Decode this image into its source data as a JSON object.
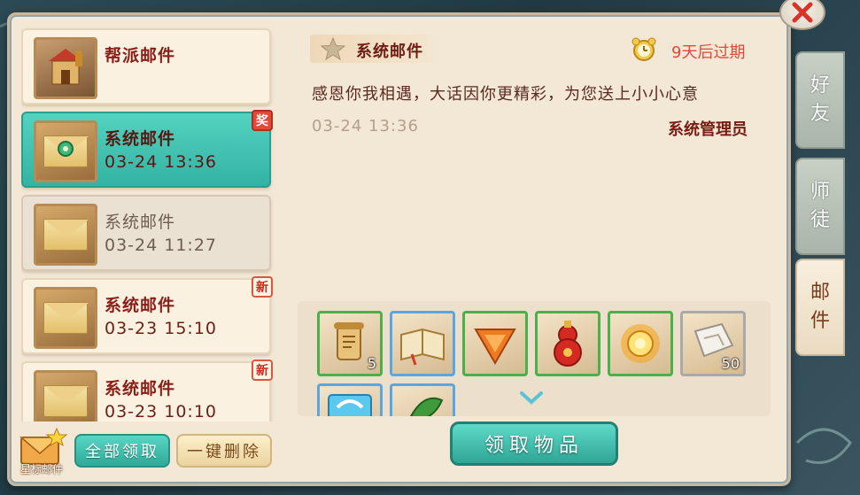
{
  "mail_list": [
    {
      "title": "帮派邮件",
      "date": "",
      "icon": "guild-building-icon",
      "state": "normal",
      "badge": ""
    },
    {
      "title": "系统邮件",
      "date": "03-24 13:36",
      "icon": "envelope-reward-icon",
      "state": "selected",
      "badge": "奖"
    },
    {
      "title": "系统邮件",
      "date": "03-24 11:27",
      "icon": "envelope-open-icon",
      "state": "read",
      "badge": ""
    },
    {
      "title": "系统邮件",
      "date": "03-23 15:10",
      "icon": "envelope-icon",
      "state": "normal",
      "badge": "新"
    },
    {
      "title": "系统邮件",
      "date": "03-23 10:10",
      "icon": "envelope-icon",
      "state": "normal",
      "badge": "新"
    }
  ],
  "footer": {
    "star_label": "星标邮件",
    "claim_all": "全部领取",
    "delete_all": "一键删除"
  },
  "detail": {
    "title": "系统邮件",
    "expire": "9天后过期",
    "body": "感恩你我相遇，大话因你更精彩，为您送上小小心意",
    "date": "03-24 13:36",
    "sender": "系统管理员",
    "claim_button": "领取物品"
  },
  "attachments": [
    {
      "icon": "scroll-item-icon",
      "qty": "5",
      "frame": "green"
    },
    {
      "icon": "book-item-icon",
      "qty": "",
      "frame": "blue"
    },
    {
      "icon": "orange-gem-icon",
      "qty": "",
      "frame": "green"
    },
    {
      "icon": "red-gourd-icon",
      "qty": "",
      "frame": "green"
    },
    {
      "icon": "gold-orb-icon",
      "qty": "",
      "frame": "green"
    },
    {
      "icon": "paper-item-icon",
      "qty": "50",
      "frame": "grey"
    },
    {
      "icon": "blue-crystal-icon",
      "qty": "",
      "frame": "blue"
    },
    {
      "icon": "leaf-item-icon",
      "qty": "",
      "frame": "blue"
    }
  ],
  "side_tabs": [
    {
      "label_1": "好",
      "label_2": "友"
    },
    {
      "label_1": "师",
      "label_2": "徒"
    },
    {
      "label_1": "邮",
      "label_2": "件"
    }
  ]
}
